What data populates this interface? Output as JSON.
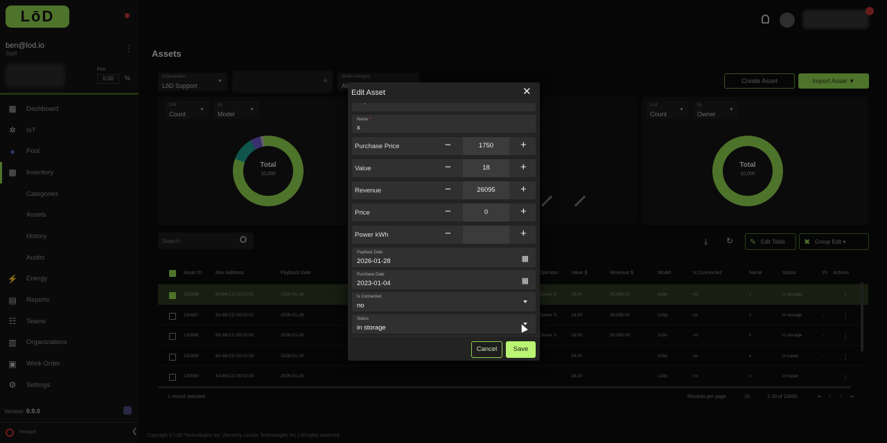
{
  "brand": {
    "logo_text": "LōD"
  },
  "user": {
    "email": "ben@lod.io",
    "role": "Staff",
    "fee_label": "Fee",
    "fee_value": "0.00",
    "fee_unit": "%"
  },
  "nav": [
    {
      "label": "Dashboard",
      "icon": "grid-icon"
    },
    {
      "label": "IoT",
      "icon": "network-icon"
    },
    {
      "label": "Pool",
      "icon": "pool-icon"
    },
    {
      "label": "Inventory",
      "icon": "qr-icon"
    },
    {
      "label": "Categories",
      "sub": true
    },
    {
      "label": "Assets",
      "sub": true
    },
    {
      "label": "History",
      "sub": true
    },
    {
      "label": "Audits",
      "sub": true
    },
    {
      "label": "Energy",
      "icon": "bolt-icon"
    },
    {
      "label": "Reports",
      "icon": "report-icon"
    },
    {
      "label": "Teams",
      "icon": "team-icon"
    },
    {
      "label": "Organizations",
      "icon": "building-icon"
    },
    {
      "label": "Work Order",
      "icon": "clipboard-icon"
    },
    {
      "label": "Settings",
      "icon": "gear-icon"
    }
  ],
  "version": {
    "label": "Version:",
    "value": "0.9.0"
  },
  "sidebar_footer": {
    "label": "Hotspot"
  },
  "page": {
    "title": "Assets",
    "copyright": "Copyright © LōD Technologies Inc. (formerly Lincoln Technologies Inc.) All rights reserved."
  },
  "filters": {
    "organization": {
      "label": "Organization",
      "value": "LōD Support"
    },
    "model_category": {
      "label": "Model category",
      "value": "All"
    },
    "left_unit": {
      "label": "Unit",
      "value": "Count"
    },
    "left_by": {
      "label": "By",
      "value": "Model"
    },
    "right_unit": {
      "label": "Unit",
      "value": "Count"
    },
    "right_by": {
      "label": "By",
      "value": "Owner"
    }
  },
  "actions": {
    "create_asset": "Create Asset",
    "import_asset": "Import Asset"
  },
  "charts": {
    "left": {
      "total_label": "Total",
      "total_value": "10,000"
    },
    "right": {
      "total_label": "Total",
      "total_value": "10,000"
    }
  },
  "search": {
    "placeholder": "Search"
  },
  "table_actions": {
    "edit_table": "Edit Table",
    "group_edit": "Group Edit"
  },
  "table": {
    "headers": [
      "Asset ID",
      "Mac Address",
      "Payback Date",
      "...",
      "...",
      "...",
      "...",
      "...",
      "Operator",
      "Value $",
      "Revenue $",
      "Model",
      "Is Connected",
      "Name",
      "Status",
      "Pr",
      "Actions"
    ],
    "rows": [
      {
        "id": "132686",
        "mac": "8A:88:CC:00:02:01",
        "date": "2026-01-28",
        "op": "Owner S",
        "value": "18.00",
        "revenue": "26,095.00",
        "model": "x19p",
        "conn": "no",
        "name": "x",
        "status": "in storage",
        "pr": "-",
        "sel": true
      },
      {
        "id": "132687",
        "mac": "8A:88:CC:00:02:02",
        "date": "2026-01-28",
        "op": "Owner S",
        "value": "18.00",
        "revenue": "26,095.00",
        "model": "x19p",
        "conn": "no",
        "name": "x",
        "status": "in storage",
        "pr": "-",
        "sel": false
      },
      {
        "id": "132688",
        "mac": "8A:88:CC:00:02:03",
        "date": "2026-01-29",
        "op": "Owner S",
        "value": "18.00",
        "revenue": "26,050.00",
        "model": "x19s",
        "conn": "no",
        "name": "x",
        "status": "in storage",
        "pr": "-",
        "sel": false
      },
      {
        "id": "132689",
        "mac": "8A:88:CC:00:02:04",
        "date": "2026-01-29",
        "op": "",
        "value": "18.00",
        "revenue": "-",
        "model": "x19p",
        "conn": "no",
        "name": "x",
        "status": "in repair",
        "pr": "-",
        "sel": false
      },
      {
        "id": "132690",
        "mac": "8A:88:CC:00:02:05",
        "date": "2026-01-28",
        "op": "",
        "value": "18.00",
        "revenue": "-",
        "model": "x19p",
        "conn": "no",
        "name": "x",
        "status": "in repair",
        "pr": "-",
        "sel": false
      }
    ],
    "footer": {
      "selected": "1 record selected",
      "per_page_label": "Records per page",
      "per_page": "10",
      "range": "1-10 of 10000"
    }
  },
  "dialog": {
    "title": "Edit Asset",
    "partial_value": "stop",
    "name": {
      "label": "Name",
      "required_mark": "*",
      "value": "x"
    },
    "purchase_price": {
      "label": "Purchase Price",
      "value": "1750"
    },
    "value": {
      "label": "Value",
      "value": "18"
    },
    "revenue": {
      "label": "Revenue",
      "value": "26095"
    },
    "price": {
      "label": "Price",
      "value": "0"
    },
    "power_kwh": {
      "label": "Power kWh",
      "value": ""
    },
    "payback_date": {
      "label": "Payback Date",
      "value": "2026-01-28"
    },
    "purchase_date": {
      "label": "Purchase Date",
      "value": "2023-01-04"
    },
    "is_connected": {
      "label": "Is Connected",
      "value": "no"
    },
    "status": {
      "label": "Status",
      "value": "in storage"
    },
    "cancel": "Cancel",
    "save": "Save",
    "minus_glyph": "−",
    "plus_glyph": "+"
  },
  "colors": {
    "accent": "#8fd14f",
    "save_bg": "#b9f472",
    "dialog_bg": "#232323",
    "field_bg": "#303030"
  }
}
